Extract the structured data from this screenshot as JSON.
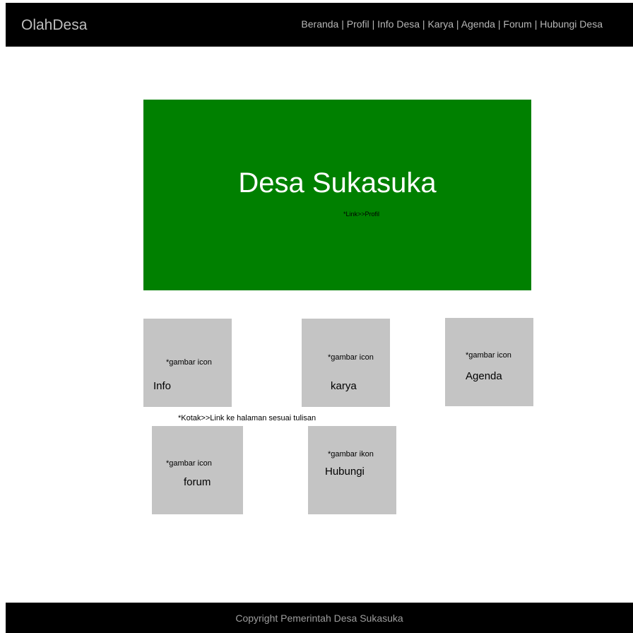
{
  "header": {
    "logo": "OlahDesa",
    "nav": [
      "Beranda",
      "Profil",
      "Info Desa",
      "Karya",
      "Agenda",
      "Forum",
      "Hubungi Desa"
    ],
    "separator": "|"
  },
  "hero": {
    "title": "Desa Sukasuka",
    "note": "*Link>>Profil"
  },
  "tiles": [
    {
      "note": "*gambar icon",
      "label": "Info"
    },
    {
      "note": "*gambar icon",
      "label": "karya"
    },
    {
      "note": "*gambar icon",
      "label": "Agenda"
    },
    {
      "note": "*gambar icon",
      "label": "forum"
    },
    {
      "note": "*gambar ikon",
      "label": "Hubungi"
    }
  ],
  "hint": "*Kotak>>Link ke halaman sesuai  tulisan",
  "footer": {
    "text": "Copyright Pemerintah Desa Sukasuka"
  },
  "colors": {
    "header_bg": "#000000",
    "hero_bg": "#008000",
    "tile_bg": "#c4c4c4"
  }
}
